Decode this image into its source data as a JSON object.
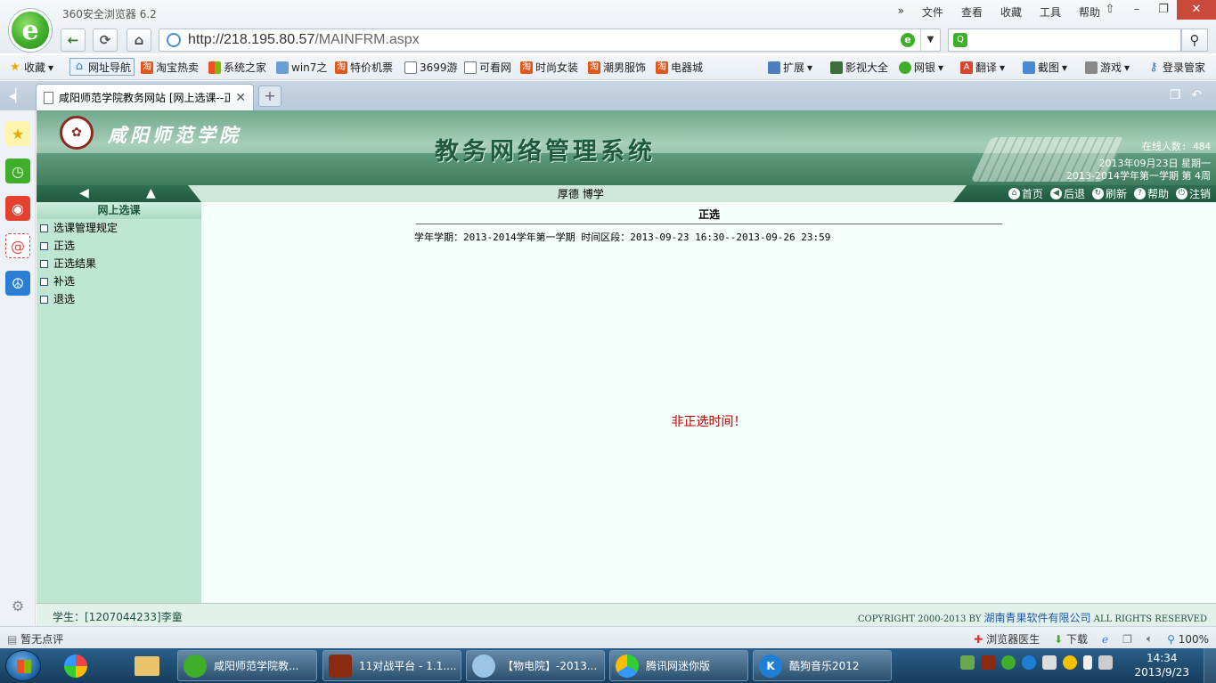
{
  "browser": {
    "title": "360安全浏览器 6.2",
    "menu": [
      "»",
      "文件",
      "查看",
      "收藏",
      "工具",
      "帮助"
    ],
    "url_host": "http://218.195.80.57",
    "url_path": "/MAINFRM.aspx",
    "favorites": [
      "收藏",
      "网址导航",
      "淘宝热卖",
      "系统之家",
      "win7之",
      "特价机票",
      "3699游",
      "可看网",
      "时尚女装",
      "潮男服饰",
      "电器城"
    ],
    "favorites_right": [
      "扩展",
      "影视大全",
      "网银",
      "翻译",
      "截图",
      "游戏",
      "登录管家"
    ],
    "tab_title": "咸阳师范学院教务网站 [网上选课--正",
    "status_left": "暂无点评",
    "status_doctor": "浏览器医生",
    "status_download": "下载",
    "zoom": "100%"
  },
  "site": {
    "school_name": "咸阳师范学院",
    "system_name": "教务网络管理系统",
    "online_label": "在线人数: 484",
    "date_line": "2013年09月23日 星期一",
    "term_line": "2013-2014学年第一学期 第 4周",
    "motto": "厚德 博学",
    "toolbar_links": [
      "首页",
      "后退",
      "刷新",
      "帮助",
      "注销"
    ]
  },
  "left_menu": {
    "title": "网上选课",
    "items": [
      "选课管理规定",
      "正选",
      "正选结果",
      "补选",
      "退选"
    ]
  },
  "main": {
    "title": "正选",
    "info": "学年学期：2013-2014学年第一学期  时间区段：2013-09-23 16:30--2013-09-26 23:59",
    "message": "非正选时间！"
  },
  "footer": {
    "student": "学生：[1207044233]李童",
    "copyright_prefix": "COPYRIGHT 2000-2013 BY",
    "company": "湖南青果软件有限公司",
    "copyright_suffix": "ALL RIGHTS RESERVED"
  },
  "taskbar": {
    "tasks": [
      "咸阳师范学院教...",
      "11对战平台 - 1.1....",
      "【物电院】-2013...",
      "腾讯网迷你版",
      "酷狗音乐2012"
    ],
    "time": "14:34",
    "date": "2013/9/23"
  }
}
